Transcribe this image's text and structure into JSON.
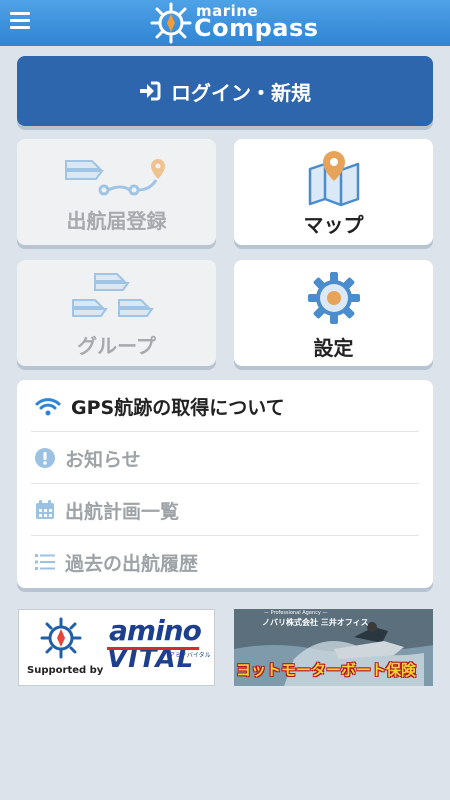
{
  "header": {
    "logo_line1": "marine",
    "logo_line2": "Compass"
  },
  "login": {
    "label": "ログイン・新規"
  },
  "tiles": [
    {
      "label": "出航届登録",
      "enabled": false
    },
    {
      "label": "マップ",
      "enabled": true
    },
    {
      "label": "グループ",
      "enabled": false
    },
    {
      "label": "設定",
      "enabled": true
    }
  ],
  "menu": [
    {
      "label": "GPS航跡の取得について",
      "icon": "wifi-icon",
      "enabled": true
    },
    {
      "label": "お知らせ",
      "icon": "info-icon",
      "enabled": false
    },
    {
      "label": "出航計画一覧",
      "icon": "calendar-icon",
      "enabled": false
    },
    {
      "label": "過去の出航履歴",
      "icon": "list-icon",
      "enabled": false
    }
  ],
  "banners": {
    "left": {
      "supported_by": "Supported by",
      "brand_line1": "amino",
      "brand_line2": "VITAL",
      "brand_kana": "アミノバイタル"
    },
    "right": {
      "agency_small": "— Professional Agency —",
      "company": "ノバリ株式会社 三井オフィス",
      "insurance": "ヨットモーターボート保険"
    }
  },
  "colors": {
    "primary": "#2d66ad",
    "header": "#3a8fdc",
    "accent_orange": "#e8a35a",
    "icon_blue": "#4a8ccc"
  }
}
